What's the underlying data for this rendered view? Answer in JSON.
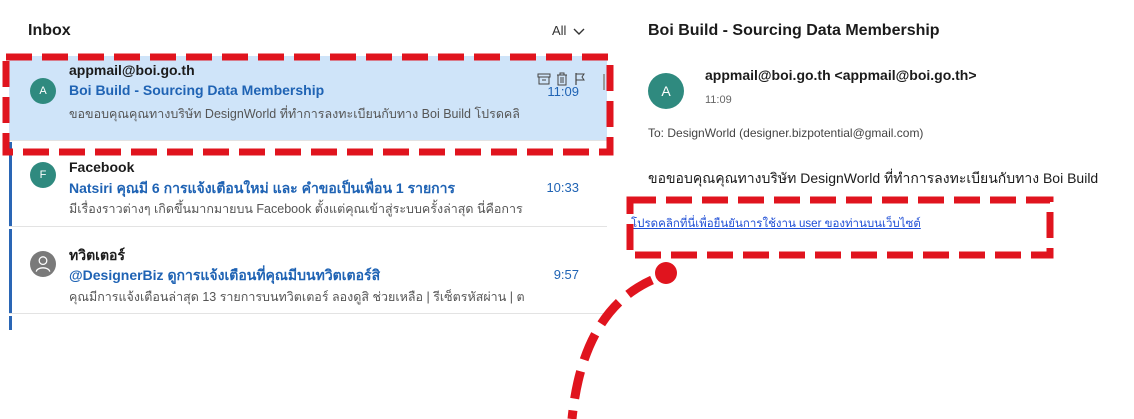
{
  "inbox": {
    "title": "Inbox",
    "filter_label": "All",
    "messages": [
      {
        "avatar_letter": "A",
        "avatar_color": "#2f8a7f",
        "sender": "appmail@boi.go.th",
        "subject": "Boi Build - Sourcing Data Membership",
        "time": "11:09",
        "preview": "ขอขอบคุณคุณทางบริษัท DesignWorld ที่ทำการลงทะเบียนกับทาง Boi Build โปรดคลิ"
      },
      {
        "avatar_letter": "F",
        "avatar_color": "#2f8a7f",
        "sender": "Facebook",
        "subject": "Natsiri คุณมี 6 การแจ้งเตือนใหม่ และ คำขอเป็นเพื่อน 1 รายการ",
        "time": "10:33",
        "preview": "มีเรื่องราวต่างๆ เกิดขึ้นมากมายบน Facebook ตั้งแต่คุณเข้าสู่ระบบครั้งล่าสุด นี่คือการ"
      },
      {
        "avatar_letter": "",
        "avatar_color": "#7a7a7a",
        "sender": "ทวิตเตอร์",
        "subject": "@DesignerBiz ดูการแจ้งเตือนที่คุณมีบนทวิตเตอร์สิ",
        "time": "9:57",
        "preview": "คุณมีการแจ้งเตือนล่าสุด 13 รายการบนทวิตเตอร์ ลองดูสิ ช่วยเหลือ | รีเซ็ตรหัสผ่าน | ต"
      }
    ]
  },
  "reading": {
    "title": "Boi Build - Sourcing Data Membership",
    "avatar_letter": "A",
    "from": "appmail@boi.go.th <appmail@boi.go.th>",
    "time": "11:09",
    "to_label": "To:",
    "to_value": "DesignWorld (designer.bizpotential@gmail.com)",
    "body": "ขอขอบคุณคุณทางบริษัท DesignWorld ที่ทำการลงทะเบียนกับทาง Boi Build",
    "link_text": "โปรดคลิกที่นี่เพื่อยืนยันการใช้งาน user ของท่านบนเว็บไซต์"
  },
  "colors": {
    "accent": "#1f63b4",
    "selected_bg": "#cfe4f9",
    "annotation_red": "#e0141e"
  },
  "icons": [
    "chevron-down-icon",
    "archive-icon",
    "trash-icon",
    "flag-icon",
    "person-icon"
  ]
}
